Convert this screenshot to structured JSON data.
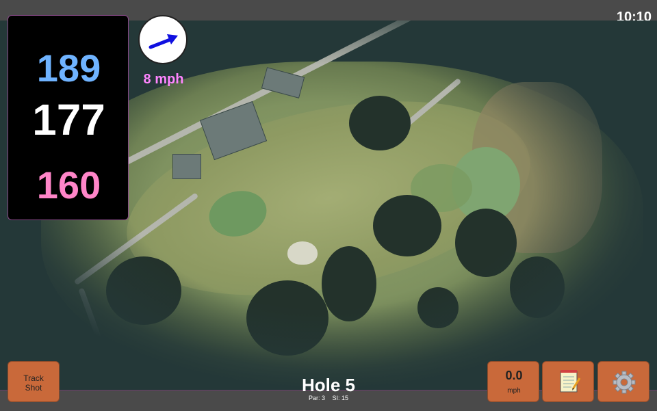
{
  "status": {
    "time": "10:10"
  },
  "distances": {
    "back": "189",
    "middle": "177",
    "front": "160"
  },
  "wind": {
    "speed_label": "8 mph",
    "icon": "wind-direction-arrow-icon",
    "color": "#1010e0"
  },
  "hole": {
    "title": "Hole 5",
    "par": "Par: 3",
    "stroke_index": "SI: 15"
  },
  "buttons": {
    "track_shot": "Track\nShot",
    "speed_value": "0.0",
    "speed_unit": "mph",
    "notes_icon": "notepad-icon",
    "settings_icon": "gear-icon"
  },
  "colors": {
    "back": "#6fb3ff",
    "middle": "#ffffff",
    "front": "#ff85c8",
    "button": "#c9693a",
    "wind_text": "#ff85ff"
  }
}
